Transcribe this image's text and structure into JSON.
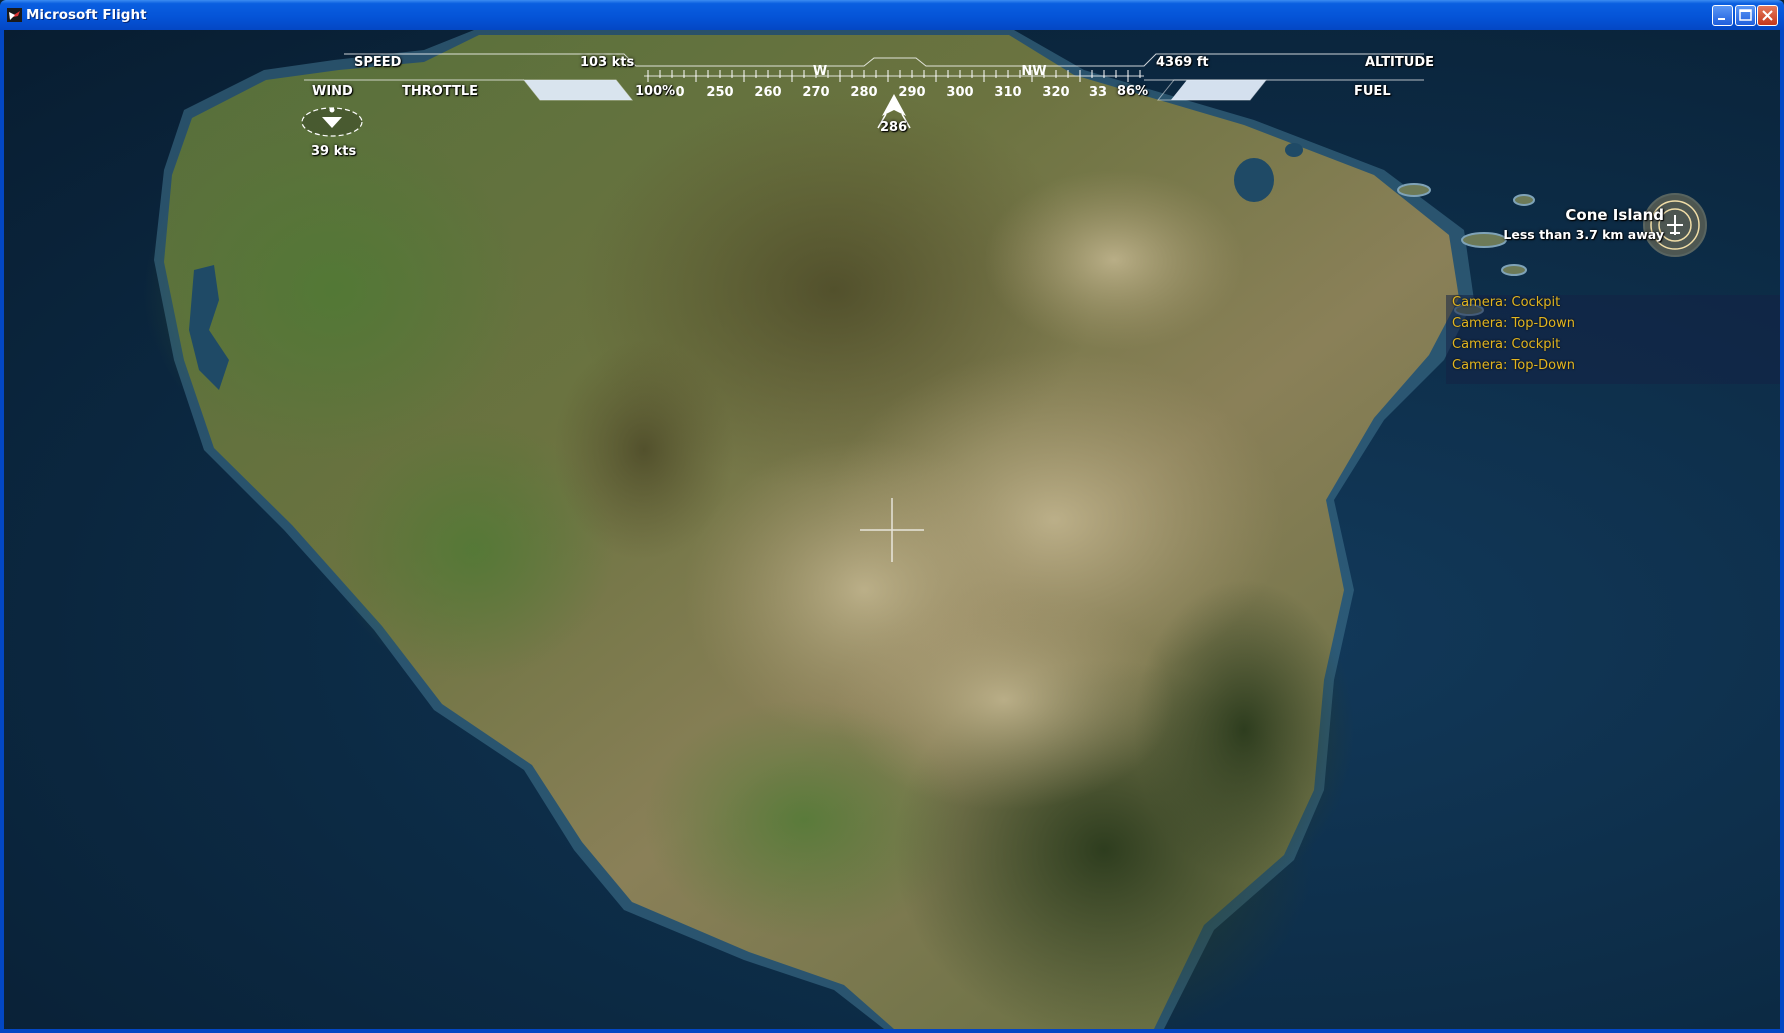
{
  "window": {
    "title": "Microsoft Flight"
  },
  "hud": {
    "speed": {
      "label": "SPEED",
      "value": "103 kts"
    },
    "altitude": {
      "label": "ALTITUDE",
      "value": "4369 ft"
    },
    "wind": {
      "label": "WIND",
      "speed": "39  kts"
    },
    "throttle": {
      "label": "THROTTLE",
      "value": "100%",
      "level": 1.0
    },
    "fuel": {
      "label": "FUEL",
      "value": "86%",
      "level": 0.86
    },
    "heading": {
      "value": "286",
      "cardinals": [
        "W",
        "NW"
      ],
      "ticks": [
        "0",
        "250",
        "260",
        "270",
        "280",
        "290",
        "300",
        "310",
        "320",
        "33"
      ]
    }
  },
  "destination": {
    "name": "Cone Island",
    "distance": "Less than 3.7 km away"
  },
  "camera_log": [
    "Camera: Cockpit",
    "Camera: Top-Down",
    "Camera: Cockpit",
    "Camera: Top-Down"
  ],
  "colors": {
    "hud_text": "#ffffff",
    "log_text": "#e2b520",
    "titlebar": "#0554d8",
    "ocean": "#0d2d48"
  },
  "icons": [
    "wind-arrow-icon",
    "heading-aircraft-icon",
    "airport-marker-icon",
    "crosshair-icon"
  ]
}
